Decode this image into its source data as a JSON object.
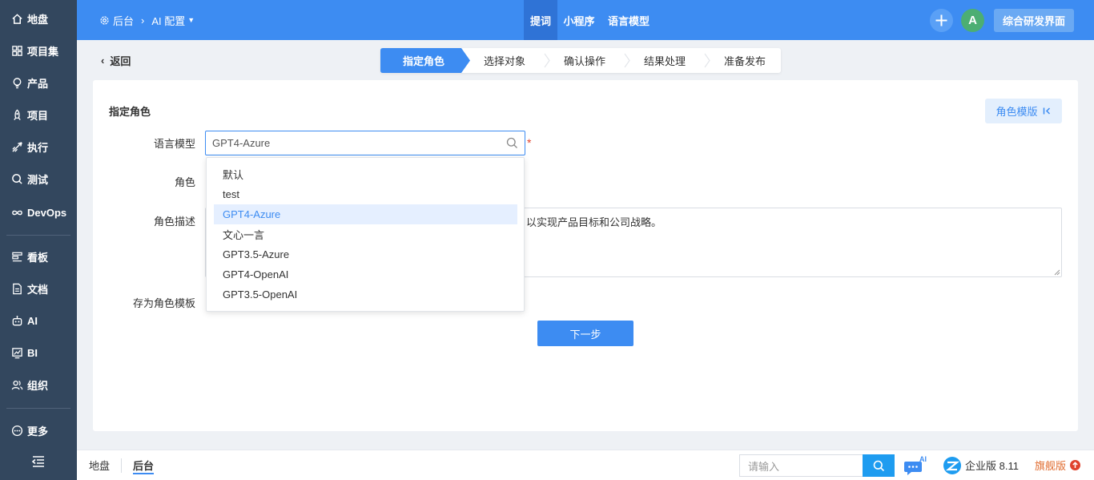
{
  "sidebar": {
    "items": [
      {
        "label": "地盘",
        "icon": "home-icon"
      },
      {
        "label": "项目集",
        "icon": "grid-icon"
      },
      {
        "label": "产品",
        "icon": "bulb-icon"
      },
      {
        "label": "项目",
        "icon": "rocket-icon"
      },
      {
        "label": "执行",
        "icon": "send-icon"
      },
      {
        "label": "测试",
        "icon": "search-icon"
      },
      {
        "label": "DevOps",
        "icon": "infinity-icon"
      },
      {
        "label": "看板",
        "icon": "kanban-icon"
      },
      {
        "label": "文档",
        "icon": "doc-icon"
      },
      {
        "label": "AI",
        "icon": "robot-icon"
      },
      {
        "label": "BI",
        "icon": "chart-icon"
      },
      {
        "label": "组织",
        "icon": "users-icon"
      },
      {
        "label": "更多",
        "icon": "more-icon"
      }
    ]
  },
  "header": {
    "breadcrumb_root": "后台",
    "breadcrumb_current": "AI 配置",
    "tabs": [
      {
        "label": "提词",
        "active": true
      },
      {
        "label": "小程序",
        "active": false
      },
      {
        "label": "语言模型",
        "active": false
      }
    ],
    "avatar_letter": "A",
    "portal_label": "综合研发界面"
  },
  "wizard": {
    "back_label": "返回",
    "steps": [
      "指定角色",
      "选择对象",
      "确认操作",
      "结果处理",
      "准备发布"
    ],
    "active_step": 0
  },
  "form": {
    "section_title": "指定角色",
    "template_button": "角色模版",
    "labels": {
      "model": "语言模型",
      "role": "角色",
      "role_desc": "角色描述",
      "save_template": "存为角色模板"
    },
    "model_value": "GPT4-Azure",
    "required_mark": "*",
    "role_desc_visible_text": "以实现产品目标和公司战略。",
    "next_button": "下一步"
  },
  "dropdown": {
    "options": [
      "默认",
      "test",
      "GPT4-Azure",
      "文心一言",
      "GPT3.5-Azure",
      "GPT4-OpenAI",
      "GPT3.5-OpenAI"
    ],
    "selected": "GPT4-Azure"
  },
  "footer": {
    "tabs": [
      {
        "label": "地盘"
      },
      {
        "label": "后台"
      }
    ],
    "search_placeholder": "请输入",
    "edition_label": "企业版 8.11",
    "flagship_label": "旗舰版",
    "ai_badge": "AI"
  },
  "colors": {
    "primary": "#3d8cf2",
    "sidebar_bg": "#33475e",
    "required": "#e0432e",
    "flagship": "#e06b2e"
  }
}
